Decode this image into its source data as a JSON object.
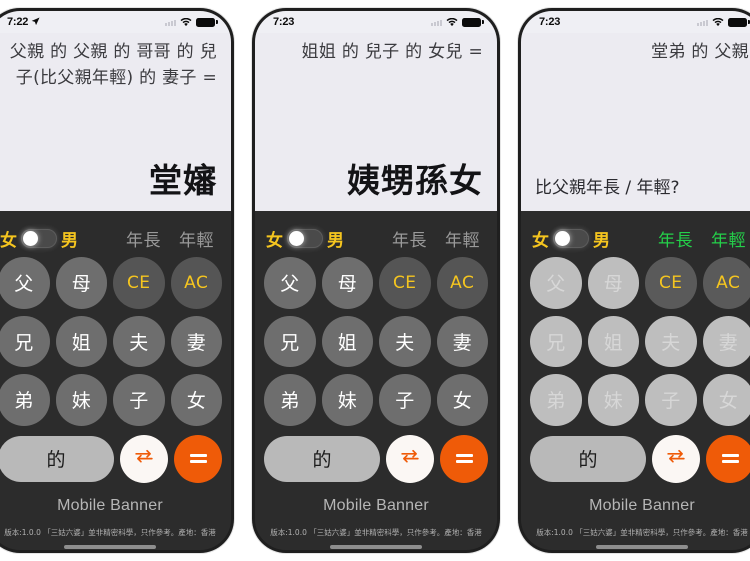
{
  "app": {
    "banner_label": "Mobile Banner",
    "footnote": "版本:1.0.0 「三姑六婆」並非精密科學，只作參考。產地：香港",
    "colors": {
      "accent_orange": "#ef5b08",
      "accent_yellow": "#f5c51f",
      "accent_green": "#24d04a",
      "key_grey": "#6e6e6e",
      "screen_bg": "#ecebf1",
      "keypad_bg": "#2c2c2c"
    }
  },
  "keypad": {
    "gender": {
      "female_label": "女",
      "male_label": "男",
      "selected": "女"
    },
    "age": {
      "older_label": "年長",
      "younger_label": "年輕"
    },
    "keys": [
      {
        "label": "父",
        "kind": "rel"
      },
      {
        "label": "母",
        "kind": "rel"
      },
      {
        "label": "CE",
        "kind": "fn"
      },
      {
        "label": "AC",
        "kind": "fn"
      },
      {
        "label": "兄",
        "kind": "rel"
      },
      {
        "label": "姐",
        "kind": "rel"
      },
      {
        "label": "夫",
        "kind": "rel"
      },
      {
        "label": "妻",
        "kind": "rel"
      },
      {
        "label": "弟",
        "kind": "rel"
      },
      {
        "label": "妹",
        "kind": "rel"
      },
      {
        "label": "子",
        "kind": "rel"
      },
      {
        "label": "女",
        "kind": "rel"
      }
    ],
    "de_label": "的",
    "swap_label": "swap-icon",
    "equals_label": "="
  },
  "phones": [
    {
      "id": "phone-1",
      "status": {
        "time": "7:22",
        "location_icon": "location-arrow-icon",
        "wifi_icon": "wifi-icon",
        "battery_icon": "battery-full-icon"
      },
      "display": {
        "mode": "result",
        "expression": "父親 的 父親 的 哥哥 的 兒子(比父親年輕) 的 妻子 =",
        "result": "堂嬸",
        "prompt": ""
      },
      "keypad_state": "normal",
      "age_active": false
    },
    {
      "id": "phone-2",
      "status": {
        "time": "7:23",
        "location_icon": "location-arrow-icon",
        "wifi_icon": "wifi-icon",
        "battery_icon": "battery-full-icon"
      },
      "display": {
        "mode": "result",
        "expression": "姐姐 的 兒子 的 女兒 =",
        "result": "姨甥孫女",
        "prompt": ""
      },
      "keypad_state": "normal",
      "age_active": false
    },
    {
      "id": "phone-3",
      "status": {
        "time": "7:23",
        "location_icon": "location-arrow-icon",
        "wifi_icon": "wifi-icon",
        "battery_icon": "battery-full-icon"
      },
      "display": {
        "mode": "question",
        "expression": "堂弟 的 父親",
        "result": "",
        "prompt": "比父親年長 / 年輕?"
      },
      "keypad_state": "dim",
      "age_active": true
    }
  ]
}
